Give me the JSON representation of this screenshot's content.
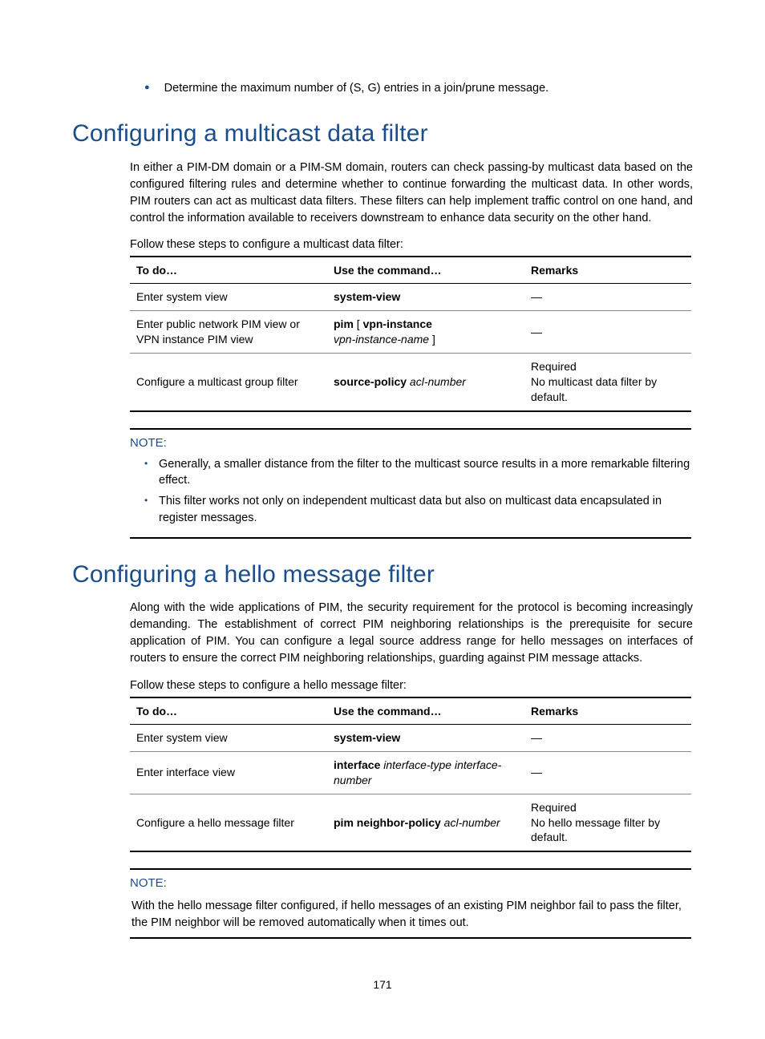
{
  "page_number": "171",
  "top_bullet": "Determine the maximum number of (S, G) entries in a join/prune message.",
  "section1": {
    "heading": "Configuring a multicast data filter",
    "para": "In either a PIM-DM domain or a PIM-SM domain, routers can check passing-by multicast data based on the configured filtering rules and determine whether to continue forwarding the multicast data. In other words, PIM routers can act as multicast data filters. These filters can help implement traffic control on one hand, and control the information available to receivers downstream to enhance data security on the other hand.",
    "lead": "Follow these steps to configure a multicast data filter:",
    "table": {
      "headers": [
        "To do…",
        "Use the command…",
        "Remarks"
      ],
      "rows": [
        {
          "todo": "Enter system view",
          "cmd_bold": "system-view",
          "cmd_ital": "",
          "remarks": "—"
        },
        {
          "todo": "Enter public network PIM view or VPN instance PIM view",
          "cmd_bold": "pim",
          "cmd_mid": " [ ",
          "cmd_bold2": "vpn-instance",
          "cmd_ital": "vpn-instance-name",
          "cmd_tail": " ]",
          "remarks": "—"
        },
        {
          "todo": "Configure a multicast group filter",
          "cmd_bold": "source-policy",
          "cmd_ital": " acl-number",
          "remarks_line1": "Required",
          "remarks_line2": "No multicast data filter by default."
        }
      ]
    },
    "note": {
      "label": "NOTE:",
      "items": [
        "Generally, a smaller distance from the filter to the multicast source results in a more remarkable filtering effect.",
        "This filter works not only on independent multicast data but also on multicast data encapsulated in register messages."
      ]
    }
  },
  "section2": {
    "heading": "Configuring a hello message filter",
    "para": "Along with the wide applications of PIM, the security requirement for the protocol is becoming increasingly demanding. The establishment of correct PIM neighboring relationships is the prerequisite for secure application of PIM. You can configure a legal source address range for hello messages on interfaces of routers to ensure the correct PIM neighboring relationships, guarding against PIM message attacks.",
    "lead": "Follow these steps to configure a hello message filter:",
    "table": {
      "headers": [
        "To do…",
        "Use the command…",
        "Remarks"
      ],
      "rows": [
        {
          "todo": "Enter system view",
          "cmd_bold": "system-view",
          "remarks": "—"
        },
        {
          "todo": "Enter interface view",
          "cmd_bold": "interface",
          "cmd_ital": " interface-type interface-number",
          "remarks": "—"
        },
        {
          "todo": "Configure a hello message filter",
          "cmd_bold": "pim neighbor-policy",
          "cmd_ital": " acl-number",
          "remarks_line1": "Required",
          "remarks_line2": "No hello message filter by default."
        }
      ]
    },
    "note": {
      "label": "NOTE:",
      "text": "With the hello message filter configured, if hello messages of an existing PIM neighbor fail to pass the filter, the PIM neighbor will be removed automatically when it times out."
    }
  }
}
